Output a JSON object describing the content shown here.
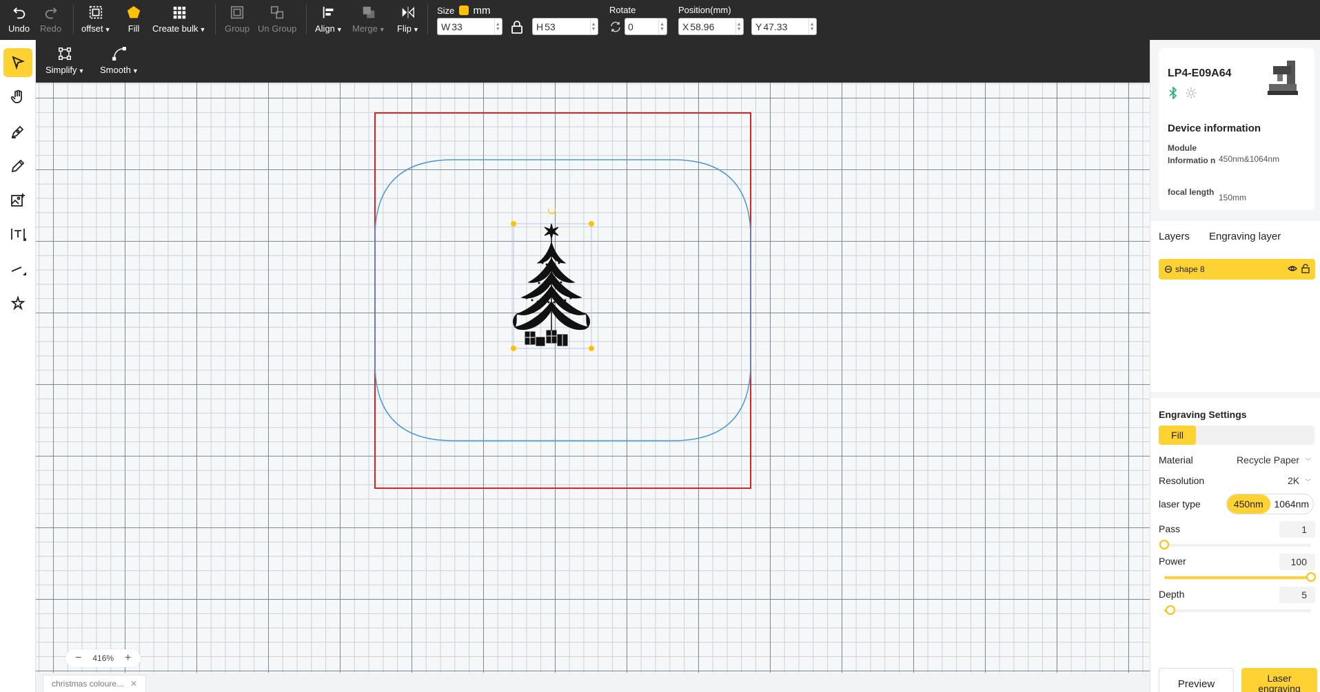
{
  "toolbar": {
    "undo": "Undo",
    "redo": "Redo",
    "offset": "offset",
    "fill": "Fill",
    "create_bulk": "Create bulk",
    "group": "Group",
    "ungroup": "Un Group",
    "align": "Align",
    "merge": "Merge",
    "flip": "Flip",
    "size_label": "Size",
    "unit": "mm",
    "width_prefix": "W",
    "width": "33",
    "height_prefix": "H",
    "height": "53",
    "rotate_label": "Rotate",
    "rotate": "0",
    "position_label": "Position(mm)",
    "x_prefix": "X",
    "x": "58.96",
    "y_prefix": "Y",
    "y": "47.33"
  },
  "subbar": {
    "simplify": "Simplify",
    "smooth": "Smooth"
  },
  "left_tools": [
    "select-icon",
    "hand-icon",
    "pen-icon",
    "pencil-icon",
    "image-add-icon",
    "text-icon",
    "line-icon",
    "magic-icon"
  ],
  "canvas": {
    "zoom": "416%",
    "file_tab": "christmas coloure...",
    "frame_color": "#e02020",
    "shape_color": "#4a9ad6",
    "selection_color": "#ffc107"
  },
  "device": {
    "name": "LP4-E09A64",
    "info_title": "Device information",
    "module_label": "Module Informatio n",
    "module_value": "450nm&1064nm",
    "focal_label": "focal length",
    "focal_value": "150mm"
  },
  "layers": {
    "tab_layers": "Layers",
    "tab_engraving": "Engraving layer",
    "item_name": "shape 8"
  },
  "settings": {
    "title": "Engraving Settings",
    "fill_tab": "Fill",
    "material_label": "Material",
    "material_value": "Recycle Paper",
    "resolution_label": "Resolution",
    "resolution_value": "2K",
    "laser_type_label": "laser type",
    "laser_450": "450nm",
    "laser_1064": "1064nm",
    "pass_label": "Pass",
    "pass_value": "1",
    "pass_fraction": 0,
    "power_label": "Power",
    "power_value": "100",
    "power_fraction": 1,
    "depth_label": "Depth",
    "depth_value": "5",
    "depth_fraction": 0.04,
    "preview": "Preview",
    "laser_engraving": "Laser engraving"
  }
}
